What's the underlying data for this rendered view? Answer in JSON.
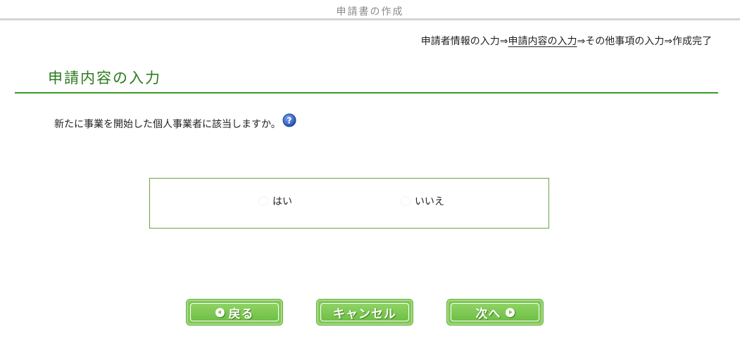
{
  "header": {
    "title": "申請書の作成"
  },
  "steps": {
    "step1": "申請者情報の入力",
    "arrow1": "⇒",
    "step2": "申請内容の入力",
    "arrow2": "⇒",
    "step3": "その他事項の入力",
    "arrow3": "⇒",
    "step4": "作成完了",
    "current_step": "申請内容の入力"
  },
  "section": {
    "heading": "申請内容の入力"
  },
  "question": {
    "text": "新たに事業を開始した個人事業者に該当しますか。",
    "help_icon": "question-help-icon"
  },
  "options": [
    {
      "label": "はい",
      "selected": false
    },
    {
      "label": "いいえ",
      "selected": false
    }
  ],
  "buttons": {
    "back_label": "戻る",
    "back_icon": "arrow-left-circle-icon",
    "cancel_label": "キャンセル",
    "next_label": "次へ",
    "next_icon": "arrow-right-circle-icon"
  },
  "colors": {
    "accent_green": "#2d7a1f",
    "rule_green": "#3c9a2a",
    "button_green": "#7fc855",
    "help_blue": "#2b5fc8"
  }
}
